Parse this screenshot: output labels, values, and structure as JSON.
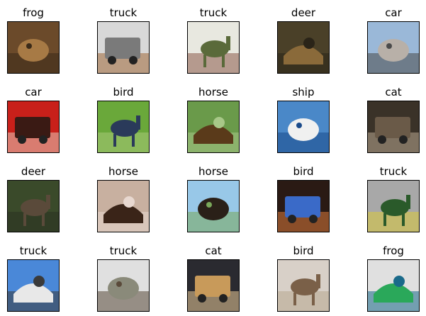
{
  "grid": {
    "rows": 4,
    "cols": 5,
    "images": [
      {
        "label": "frog",
        "scene": "frog-on-ground",
        "colors": [
          "#6b4a2a",
          "#a77a45",
          "#3a2a18"
        ]
      },
      {
        "label": "truck",
        "scene": "white-semi-truck",
        "colors": [
          "#d8d8d8",
          "#7a7a7a",
          "#a06a3a"
        ]
      },
      {
        "label": "truck",
        "scene": "dump-truck-field",
        "colors": [
          "#e8e8e0",
          "#5a6a3a",
          "#8a5a4a"
        ]
      },
      {
        "label": "deer",
        "scene": "deer-in-woods",
        "colors": [
          "#4a4028",
          "#8a6a3a",
          "#2a2418"
        ]
      },
      {
        "label": "car",
        "scene": "silver-sedan",
        "colors": [
          "#9ab8d8",
          "#b8b0a8",
          "#4a4a4a"
        ]
      },
      {
        "label": "car",
        "scene": "red-sports-car",
        "colors": [
          "#c8201a",
          "#3a1a14",
          "#e8c8b8"
        ]
      },
      {
        "label": "bird",
        "scene": "ostrich-green",
        "colors": [
          "#6aa83a",
          "#2a3a5a",
          "#a8c878"
        ]
      },
      {
        "label": "horse",
        "scene": "brown-horse",
        "colors": [
          "#6a9a4a",
          "#5a3a1a",
          "#a8c888"
        ]
      },
      {
        "label": "ship",
        "scene": "white-motorboat",
        "colors": [
          "#4a88c8",
          "#f0f0f0",
          "#1a4a8a"
        ]
      },
      {
        "label": "cat",
        "scene": "cat-dark",
        "colors": [
          "#3a3228",
          "#6a5a48",
          "#b8a890"
        ]
      },
      {
        "label": "deer",
        "scene": "deer-camouflage",
        "colors": [
          "#3a4a2a",
          "#5a4a3a",
          "#2a3220"
        ]
      },
      {
        "label": "horse",
        "scene": "horse-with-rider",
        "colors": [
          "#c8b0a0",
          "#3a2418",
          "#e8d8d0"
        ]
      },
      {
        "label": "horse",
        "scene": "dark-horse",
        "colors": [
          "#98c8e8",
          "#2a2018",
          "#7aa85a"
        ]
      },
      {
        "label": "bird",
        "scene": "bluebird-feeder",
        "colors": [
          "#2a1a14",
          "#3a6ac8",
          "#d87a3a"
        ]
      },
      {
        "label": "truck",
        "scene": "green-truck",
        "colors": [
          "#a8a8a8",
          "#2a5a2a",
          "#d8c83a"
        ]
      },
      {
        "label": "truck",
        "scene": "white-trailer",
        "colors": [
          "#4a88d8",
          "#e8e8e8",
          "#3a3a3a"
        ]
      },
      {
        "label": "truck",
        "scene": "truck-house",
        "colors": [
          "#e0e0e0",
          "#8a8a7a",
          "#5a4a3a"
        ]
      },
      {
        "label": "cat",
        "scene": "orange-cat",
        "colors": [
          "#2a2a30",
          "#c89a5a",
          "#e8c898"
        ]
      },
      {
        "label": "bird",
        "scene": "brown-bird",
        "colors": [
          "#d8d0c8",
          "#7a6048",
          "#b8a890"
        ]
      },
      {
        "label": "frog",
        "scene": "green-frog-toy",
        "colors": [
          "#e0e0e0",
          "#2aa85a",
          "#1a6a8a"
        ]
      }
    ]
  }
}
